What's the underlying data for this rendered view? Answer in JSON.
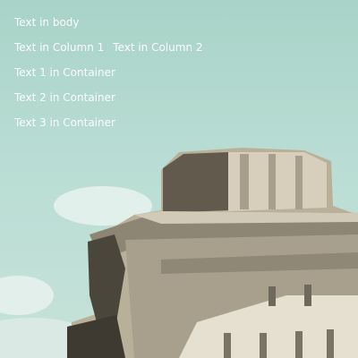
{
  "texts": {
    "body": "Text in body",
    "column_1": "Text in Column 1",
    "column_2": "Text in Column 2",
    "container_1": "Text 1 in Container",
    "container_2": "Text 2 in Container",
    "container_3": "Text 3 in Container"
  },
  "colors": {
    "sky": "#b9ddd4",
    "building_stone": "#c9c1ad",
    "building_shadow": "#5f5a4e",
    "text": "#ffffff"
  }
}
